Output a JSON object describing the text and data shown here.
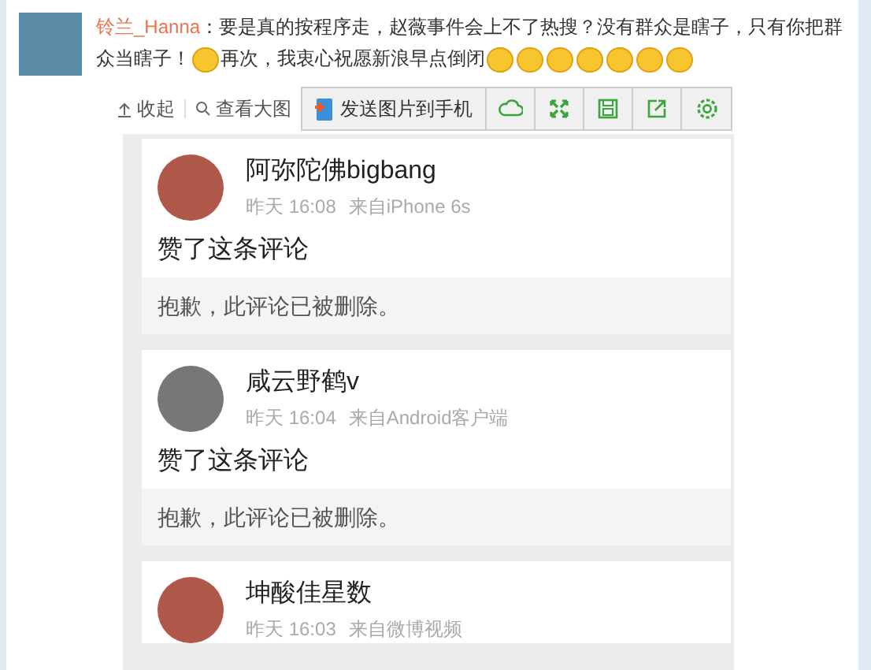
{
  "comment": {
    "author": "铃兰_Hanna",
    "separator": "：",
    "segments": [
      {
        "kind": "text",
        "text": "要是真的按程序走，赵薇事件会上不了热搜？没有群众是瞎子，只有你把群众当瞎子！"
      },
      {
        "kind": "emoji"
      },
      {
        "kind": "text",
        "text": "再次，我衷心祝愿新浪早点倒闭"
      },
      {
        "kind": "emoji"
      },
      {
        "kind": "emoji"
      },
      {
        "kind": "emoji"
      },
      {
        "kind": "emoji"
      },
      {
        "kind": "emoji"
      },
      {
        "kind": "emoji"
      },
      {
        "kind": "emoji"
      }
    ]
  },
  "toolbar": {
    "links": [
      {
        "kind": "collapse",
        "label": "收起"
      },
      {
        "kind": "zoom",
        "label": "查看大图"
      }
    ],
    "send_button": "发送图片到手机",
    "icon_buttons": [
      {
        "kind": "cloud"
      },
      {
        "kind": "expand"
      },
      {
        "kind": "save"
      },
      {
        "kind": "share"
      },
      {
        "kind": "settings"
      }
    ]
  },
  "image": {
    "posts": [
      {
        "kind": "color",
        "name": "阿弥陀佛bigbang",
        "time": "昨天 16:08",
        "source": "来自iPhone 6s",
        "text": "赞了这条评论",
        "quoted": "抱歉，此评论已被删除。"
      },
      {
        "kind": "mono",
        "name": "咸云野鹤v",
        "time": "昨天 16:04",
        "source": "来自Android客户端",
        "text": "赞了这条评论",
        "quoted": "抱歉，此评论已被删除。"
      },
      {
        "kind": "color",
        "name": "坤酸佳星数",
        "time": "昨天 16:03",
        "source": "来自微博视频"
      }
    ]
  }
}
